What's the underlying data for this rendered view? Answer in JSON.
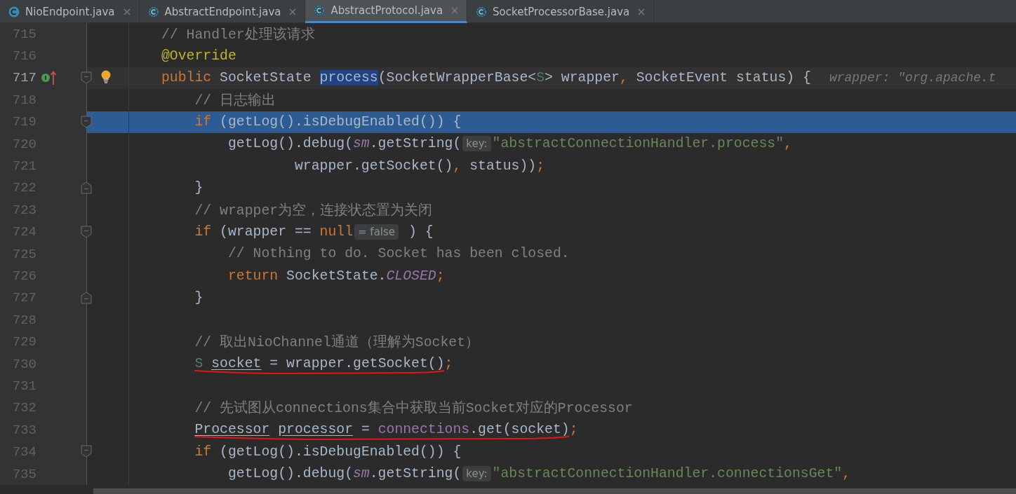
{
  "tabs": [
    {
      "label": "NioEndpoint.java",
      "kind": "class",
      "selected": false
    },
    {
      "label": "AbstractEndpoint.java",
      "kind": "abstract_class",
      "selected": false
    },
    {
      "label": "AbstractProtocol.java",
      "kind": "abstract_class",
      "selected": true
    },
    {
      "label": "SocketProcessorBase.java",
      "kind": "abstract_class",
      "selected": false
    }
  ],
  "lines": [
    {
      "number": "715",
      "current": false,
      "execution_point": false,
      "fold_start": false,
      "fold_end": false,
      "override_mark": false,
      "bulb": false,
      "red_underline": false,
      "tokens": [
        {
          "kind": "comment",
          "text": "        // Handler处理该请求"
        }
      ]
    },
    {
      "number": "716",
      "current": false,
      "execution_point": false,
      "fold_start": false,
      "fold_end": false,
      "override_mark": false,
      "bulb": false,
      "red_underline": false,
      "tokens": [
        {
          "kind": "annotation",
          "text": "        @Override"
        }
      ]
    },
    {
      "number": "717",
      "current": true,
      "execution_point": false,
      "fold_start": true,
      "fold_end": false,
      "override_mark": true,
      "bulb": true,
      "red_underline": false,
      "tokens": [
        {
          "kind": "keyword",
          "text": "        public"
        },
        {
          "kind": "plain",
          "text": " SocketState "
        },
        {
          "kind": "usage",
          "text": "process"
        },
        {
          "kind": "plain",
          "text": "(SocketWrapperBase<"
        },
        {
          "kind": "typeparam",
          "text": "S"
        },
        {
          "kind": "plain",
          "text": "> wrapper"
        },
        {
          "kind": "punct",
          "text": ","
        },
        {
          "kind": "plain",
          "text": " SocketEvent status) {"
        },
        {
          "kind": "inlay",
          "text": "wrapper: \"org.apache.t"
        }
      ]
    },
    {
      "number": "718",
      "current": false,
      "execution_point": false,
      "fold_start": false,
      "fold_end": false,
      "override_mark": false,
      "bulb": false,
      "red_underline": false,
      "tokens": [
        {
          "kind": "comment",
          "text": "            // 日志输出"
        }
      ]
    },
    {
      "number": "719",
      "current": false,
      "execution_point": true,
      "fold_start": true,
      "fold_end": false,
      "override_mark": false,
      "bulb": false,
      "red_underline": false,
      "tokens": [
        {
          "kind": "keyword",
          "text": "            if"
        },
        {
          "kind": "plain",
          "text": " (getLog().isDebugEnabled()) {"
        }
      ]
    },
    {
      "number": "720",
      "current": false,
      "execution_point": false,
      "fold_start": false,
      "fold_end": false,
      "override_mark": false,
      "bulb": false,
      "red_underline": false,
      "tokens": [
        {
          "kind": "plain",
          "text": "                getLog().debug("
        },
        {
          "kind": "field",
          "text": "sm"
        },
        {
          "kind": "plain",
          "text": ".getString("
        },
        {
          "kind": "hint",
          "text": "key:"
        },
        {
          "kind": "string",
          "text": "\"abstractConnectionHandler.process\""
        },
        {
          "kind": "punct",
          "text": ","
        }
      ]
    },
    {
      "number": "721",
      "current": false,
      "execution_point": false,
      "fold_start": false,
      "fold_end": false,
      "override_mark": false,
      "bulb": false,
      "red_underline": false,
      "tokens": [
        {
          "kind": "plain",
          "text": "                        wrapper.getSocket()"
        },
        {
          "kind": "punct",
          "text": ","
        },
        {
          "kind": "plain",
          "text": " status))"
        },
        {
          "kind": "punct",
          "text": ";"
        }
      ]
    },
    {
      "number": "722",
      "current": false,
      "execution_point": false,
      "fold_start": false,
      "fold_end": true,
      "override_mark": false,
      "bulb": false,
      "red_underline": false,
      "tokens": [
        {
          "kind": "plain",
          "text": "            }"
        }
      ]
    },
    {
      "number": "723",
      "current": false,
      "execution_point": false,
      "fold_start": false,
      "fold_end": false,
      "override_mark": false,
      "bulb": false,
      "red_underline": false,
      "tokens": [
        {
          "kind": "comment",
          "text": "            // wrapper为空，连接状态置为关闭"
        }
      ]
    },
    {
      "number": "724",
      "current": false,
      "execution_point": false,
      "fold_start": true,
      "fold_end": false,
      "override_mark": false,
      "bulb": false,
      "red_underline": false,
      "tokens": [
        {
          "kind": "keyword",
          "text": "            if"
        },
        {
          "kind": "plain",
          "text": " (wrapper == "
        },
        {
          "kind": "keyword",
          "text": "null"
        },
        {
          "kind": "hint",
          "text": "= false"
        },
        {
          "kind": "plain",
          "text": " ) {"
        }
      ]
    },
    {
      "number": "725",
      "current": false,
      "execution_point": false,
      "fold_start": false,
      "fold_end": false,
      "override_mark": false,
      "bulb": false,
      "red_underline": false,
      "tokens": [
        {
          "kind": "comment",
          "text": "                // Nothing to do. Socket has been closed."
        }
      ]
    },
    {
      "number": "726",
      "current": false,
      "execution_point": false,
      "fold_start": false,
      "fold_end": false,
      "override_mark": false,
      "bulb": false,
      "red_underline": false,
      "tokens": [
        {
          "kind": "keyword",
          "text": "                return"
        },
        {
          "kind": "plain",
          "text": " SocketState."
        },
        {
          "kind": "static",
          "text": "CLOSED"
        },
        {
          "kind": "punct",
          "text": ";"
        }
      ]
    },
    {
      "number": "727",
      "current": false,
      "execution_point": false,
      "fold_start": false,
      "fold_end": true,
      "override_mark": false,
      "bulb": false,
      "red_underline": false,
      "tokens": [
        {
          "kind": "plain",
          "text": "            }"
        }
      ]
    },
    {
      "number": "728",
      "current": false,
      "execution_point": false,
      "fold_start": false,
      "fold_end": false,
      "override_mark": false,
      "bulb": false,
      "red_underline": false
    },
    {
      "number": "729",
      "current": false,
      "execution_point": false,
      "fold_start": false,
      "fold_end": false,
      "override_mark": false,
      "bulb": false,
      "red_underline": false,
      "tokens": [
        {
          "kind": "comment",
          "text": "            // 取出NioChannel通道（理解为Socket）"
        }
      ]
    },
    {
      "number": "730",
      "current": false,
      "execution_point": false,
      "fold_start": false,
      "fold_end": false,
      "override_mark": false,
      "bulb": false,
      "red_underline": true,
      "tokens": [
        {
          "kind": "typeparam",
          "text": "            S"
        },
        {
          "kind": "underlined",
          "text": " socket"
        },
        {
          "kind": "plain",
          "text": " = wrapper.getSocket()"
        },
        {
          "kind": "punct",
          "text": ";"
        }
      ]
    },
    {
      "number": "731",
      "current": false,
      "execution_point": false,
      "fold_start": false,
      "fold_end": false,
      "override_mark": false,
      "bulb": false,
      "red_underline": false
    },
    {
      "number": "732",
      "current": false,
      "execution_point": false,
      "fold_start": false,
      "fold_end": false,
      "override_mark": false,
      "bulb": false,
      "red_underline": false,
      "tokens": [
        {
          "kind": "comment",
          "text": "            // 先试图从connections集合中获取当前Socket对应的Processor"
        }
      ]
    },
    {
      "number": "733",
      "current": false,
      "execution_point": false,
      "fold_start": false,
      "fold_end": false,
      "override_mark": false,
      "bulb": false,
      "red_underline": true,
      "tokens": [
        {
          "kind": "underlined",
          "text": "            Processor"
        },
        {
          "kind": "underlined",
          "text": " processor"
        },
        {
          "kind": "plain",
          "text": " = "
        },
        {
          "kind": "fieldref",
          "text": "connections"
        },
        {
          "kind": "plain",
          "text": ".get(socket)"
        },
        {
          "kind": "punct",
          "text": ";"
        }
      ]
    },
    {
      "number": "734",
      "current": false,
      "execution_point": false,
      "fold_start": true,
      "fold_end": false,
      "override_mark": false,
      "bulb": false,
      "red_underline": false,
      "tokens": [
        {
          "kind": "keyword",
          "text": "            if"
        },
        {
          "kind": "plain",
          "text": " (getLog().isDebugEnabled()) {"
        }
      ]
    },
    {
      "number": "735",
      "current": false,
      "execution_point": false,
      "fold_start": false,
      "fold_end": false,
      "override_mark": false,
      "bulb": false,
      "red_underline": false,
      "tokens": [
        {
          "kind": "plain",
          "text": "                getLog().debug("
        },
        {
          "kind": "field",
          "text": "sm"
        },
        {
          "kind": "plain",
          "text": ".getString("
        },
        {
          "kind": "hint",
          "text": "key:"
        },
        {
          "kind": "string",
          "text": "\"abstractConnectionHandler.connectionsGet\""
        },
        {
          "kind": "punct",
          "text": ","
        }
      ]
    }
  ]
}
